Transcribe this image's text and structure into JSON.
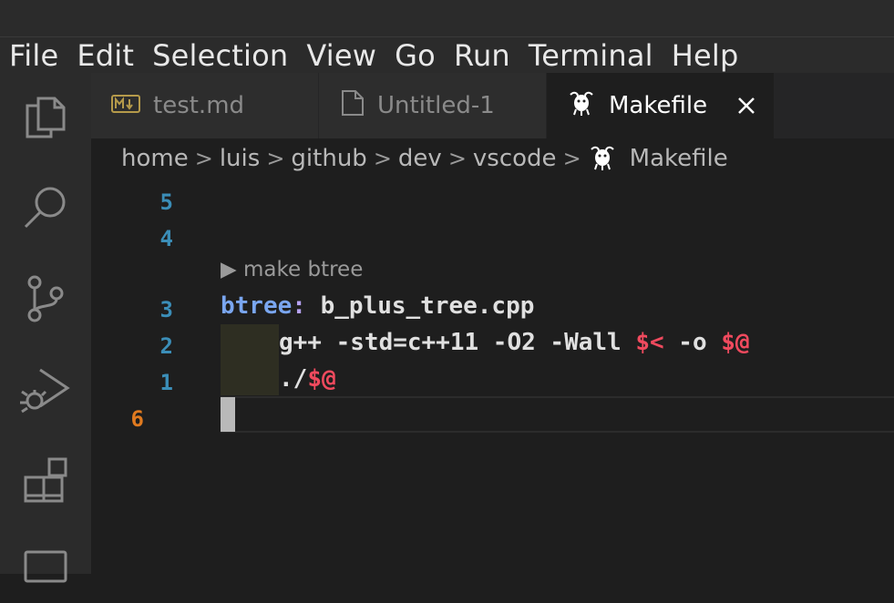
{
  "menu": [
    "File",
    "Edit",
    "Selection",
    "View",
    "Go",
    "Run",
    "Terminal",
    "Help"
  ],
  "tabs": [
    {
      "label": "test.md",
      "icon": "markdown-icon",
      "active": false
    },
    {
      "label": "Untitled-1",
      "icon": "file-icon",
      "active": false
    },
    {
      "label": "Makefile",
      "icon": "gnu-icon",
      "active": true
    }
  ],
  "breadcrumb": [
    "home",
    "luis",
    "github",
    "dev",
    "vscode",
    "Makefile"
  ],
  "editor": {
    "line_numbers": [
      "5",
      "4",
      "3",
      "2",
      "1",
      "6"
    ],
    "codelens": "make btree",
    "line_target": "btree",
    "line_colon": ":",
    "line_deps": " b_plus_tree.cpp",
    "line2_cmd": "g++ -std=c++11 -O2 -Wall ",
    "line2_auto1": "$<",
    "line2_opt": " -o ",
    "line2_auto2": "$@",
    "line1_cmd": "./",
    "line1_auto": "$@"
  },
  "colors": {
    "accent_line_number": "#3b8eb8",
    "current_line_number": "#e07a1f",
    "automatic_variable": "#f04a5e",
    "target": "#7aa6f0"
  }
}
